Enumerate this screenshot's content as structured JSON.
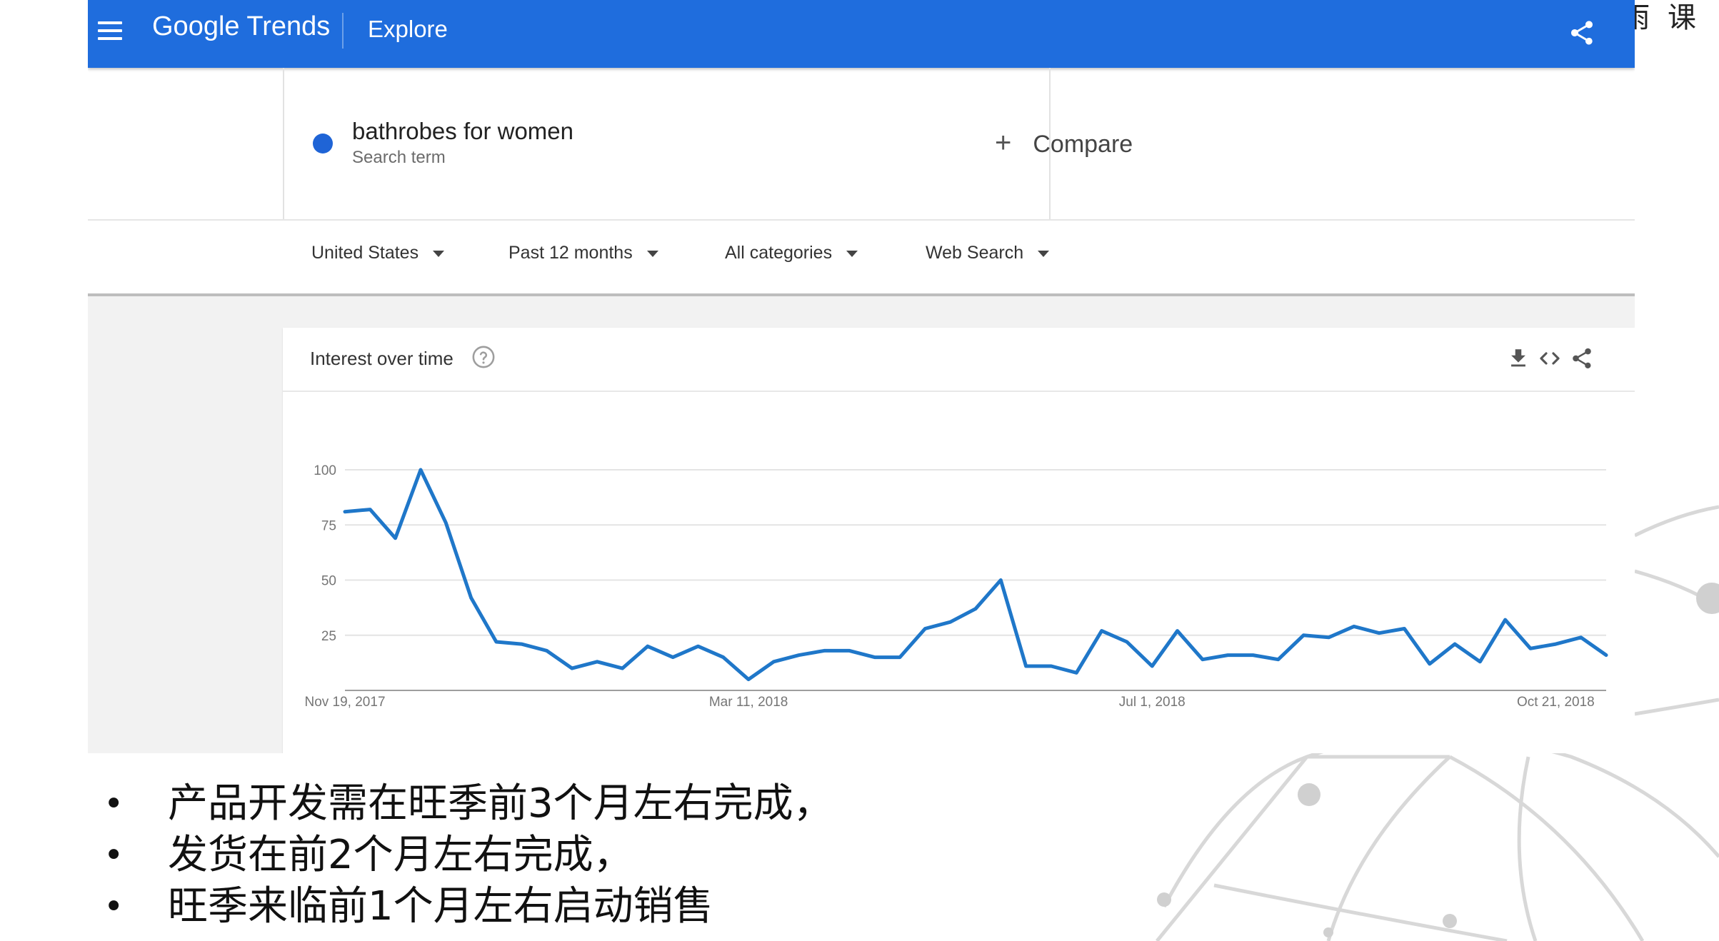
{
  "watermark": "雨 课",
  "header": {
    "brand": "Google Trends",
    "section": "Explore"
  },
  "search": {
    "term": "bathrobes for women",
    "term_type": "Search term",
    "term_color": "#1f64d6",
    "compare_label": "Compare"
  },
  "filters": {
    "region": "United States",
    "period": "Past 12 months",
    "category": "All categories",
    "property": "Web Search"
  },
  "card": {
    "title": "Interest over time"
  },
  "chart_data": {
    "type": "line",
    "title": "Interest over time",
    "ylim": [
      0,
      100
    ],
    "y_ticks": [
      100,
      75,
      50,
      25
    ],
    "x_tick_labels": [
      "Nov 19, 2017",
      "Mar 11, 2018",
      "Jul 1, 2018",
      "Oct 21, 2018"
    ],
    "x_tick_indices": [
      0,
      16,
      32,
      48
    ],
    "grid": true,
    "line_color": "#1f77c9",
    "series": [
      {
        "name": "bathrobes for women",
        "values": [
          81,
          82,
          69,
          100,
          76,
          42,
          22,
          21,
          18,
          10,
          13,
          10,
          20,
          15,
          20,
          15,
          5,
          13,
          16,
          18,
          18,
          15,
          15,
          28,
          31,
          37,
          50,
          11,
          11,
          8,
          27,
          22,
          11,
          27,
          14,
          16,
          16,
          14,
          25,
          24,
          29,
          26,
          28,
          12,
          21,
          13,
          32,
          19,
          21,
          24,
          16
        ]
      }
    ]
  },
  "bullets": [
    "产品开发需在旺季前3个月左右完成，",
    "发货在前2个月左右完成，",
    "旺季来临前1个月左右启动销售"
  ]
}
